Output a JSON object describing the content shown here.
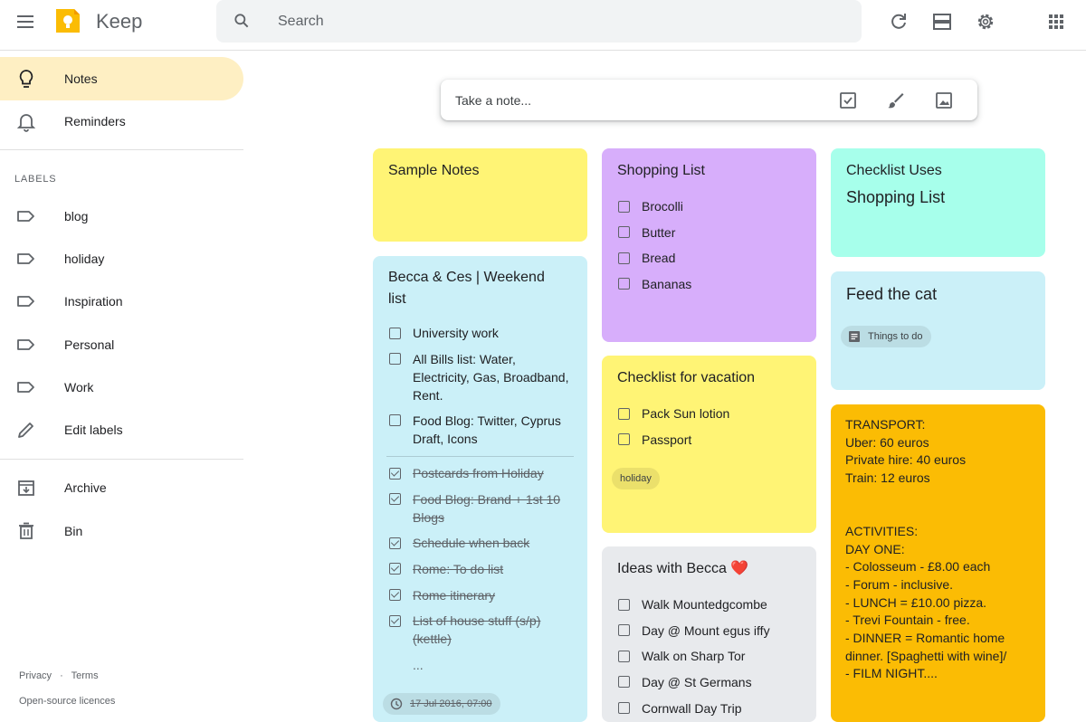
{
  "header": {
    "app_name": "Keep",
    "search_placeholder": "Search",
    "icons": [
      "menu-icon",
      "keep-logo-icon",
      "search-icon",
      "refresh-icon",
      "list-view-icon",
      "settings-icon",
      "apps-icon"
    ]
  },
  "sidebar": {
    "nav": [
      {
        "label": "Notes",
        "icon": "lightbulb-icon",
        "active": true
      },
      {
        "label": "Reminders",
        "icon": "bell-icon"
      }
    ],
    "labels_title": "LABELS",
    "labels": [
      {
        "label": "blog",
        "icon": "label-icon"
      },
      {
        "label": "holiday",
        "icon": "label-icon"
      },
      {
        "label": "Inspiration",
        "icon": "label-icon"
      },
      {
        "label": "Personal",
        "icon": "label-icon"
      },
      {
        "label": "Work",
        "icon": "label-icon"
      },
      {
        "label": "Edit labels",
        "icon": "pencil-icon"
      }
    ],
    "bottom": [
      {
        "label": "Archive",
        "icon": "archive-icon"
      },
      {
        "label": "Bin",
        "icon": "trash-icon"
      }
    ],
    "footer": {
      "privacy": "Privacy",
      "sep": "·",
      "terms": "Terms",
      "licences": "Open-source licences"
    }
  },
  "take_note": {
    "placeholder": "Take a note..."
  },
  "colors": {
    "yellow": "#fff475",
    "blue": "#cbf0f8",
    "purple": "#d7aefb",
    "teal": "#a7ffeb",
    "grey": "#e8eaed",
    "orange": "#fbbc04",
    "active_nav": "#feefc3"
  },
  "notes": {
    "sample": {
      "title": "Sample Notes"
    },
    "becca": {
      "title_line1": "Becca & Ces | Weekend",
      "title_line2": "list",
      "unchecked": [
        [
          "University work"
        ],
        [
          "All Bills list: Water,",
          "Electricity, Gas, Broadband,",
          "Rent."
        ],
        [
          "Food Blog: Twitter, Cyprus",
          "Draft, Icons"
        ]
      ],
      "checked": [
        [
          "Postcards from Holiday"
        ],
        [
          "Food Blog: Brand + 1st 10",
          "Blogs"
        ],
        [
          "Schedule when back"
        ],
        [
          "Rome: To do list"
        ],
        [
          "Rome itinerary"
        ],
        [
          "List of house stuff (s/p)",
          "(kettle)"
        ]
      ],
      "ellipsis": "...",
      "reminder": "17 Jul 2016, 07:00"
    },
    "shopping": {
      "title": "Shopping List",
      "items": [
        "Brocolli",
        "Butter",
        "Bread",
        "Bananas"
      ]
    },
    "vacation": {
      "title": "Checklist for vacation",
      "items": [
        "Pack Sun lotion",
        "Passport"
      ],
      "label": "holiday"
    },
    "ideas": {
      "title": "Ideas with Becca ❤️",
      "items": [
        "Walk Mountedgcombe",
        "Day @ Mount egus iffy",
        "Walk on Sharp Tor",
        "Day @ St Germans",
        "Cornwall Day Trip"
      ]
    },
    "checklist_uses": {
      "title": "Checklist Uses",
      "body": "Shopping List"
    },
    "cat": {
      "title": "Feed the cat",
      "chip": "Things to do"
    },
    "transport": {
      "lines": [
        "TRANSPORT:",
        "Uber: 60 euros",
        "Private hire: 40 euros",
        "Train: 12 euros",
        "",
        "ACTIVITIES:",
        "DAY ONE:",
        "- Colosseum - £8.00 each",
        "- Forum - inclusive.",
        "- LUNCH = £10.00 pizza.",
        "- Trevi Fountain - free.",
        "- DINNER = Romantic home",
        "dinner. [Spaghetti with wine]/",
        "- FILM NIGHT...."
      ]
    }
  }
}
